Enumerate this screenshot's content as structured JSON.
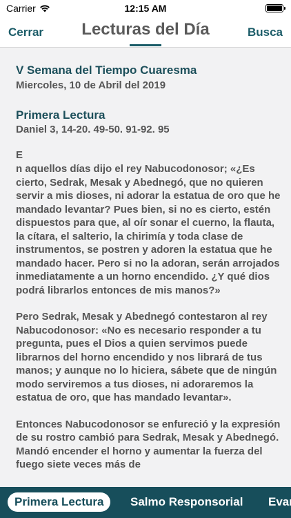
{
  "status_bar": {
    "carrier": "Carrier",
    "time": "12:15 AM"
  },
  "nav": {
    "left_label": "Cerrar",
    "title": "Lecturas del Día",
    "right_label": "Busca"
  },
  "reading": {
    "week": "V Semana del Tiempo Cuaresma",
    "date": "Miercoles, 10 de Abril del 2019",
    "section": "Primera Lectura",
    "citation": "Daniel 3, 14-20. 49-50. 91-92. 95",
    "dropcap": "E",
    "paragraphs": [
      "n aquellos días dijo el rey Nabucodonosor; «¿Es cierto, Sedrak, Mesak y Abednegó, que no quieren servir a mis dioses, ni adorar la estatua de oro que he mandado levantar? Pues bien, si no es cierto, estén dispuestos para que, al oír sonar el cuerno, la flauta, la cítara, el salterio, la chirimía y toda clase de instrumentos, se postren y adoren la estatua que he mandado hacer. Pero si no la adoran, serán arrojados inmediatamente a un horno encendido. ¿Y qué dios podrá librarlos entonces de mis manos?»",
      "Pero Sedrak, Mesak y Abednegó contestaron al rey Nabucodonosor: «No es necesario responder a tu pregunta, pues el Dios a quien servimos puede librarnos del horno encendido y nos librará de tus manos; y aunque no lo hiciera, sábete que de ningún modo serviremos a tus dioses, ni adoraremos la estatua de oro, que has mandado levantar».",
      "Entonces Nabucodonosor se enfureció y la expresión de su rostro cambió para Sedrak, Mesak y Abednegó. Mandó encender el horno y aumentar la fuerza del fuego siete veces más de"
    ]
  },
  "tabs": [
    {
      "label": "Primera Lectura",
      "active": true
    },
    {
      "label": "Salmo Responsorial",
      "active": false
    },
    {
      "label": "Evan",
      "active": false
    }
  ],
  "colors": {
    "accent": "#1b5c68",
    "tab_bar": "#174e5b",
    "background": "#f2f2f3"
  },
  "icons": [
    "wifi-icon",
    "battery-icon"
  ]
}
